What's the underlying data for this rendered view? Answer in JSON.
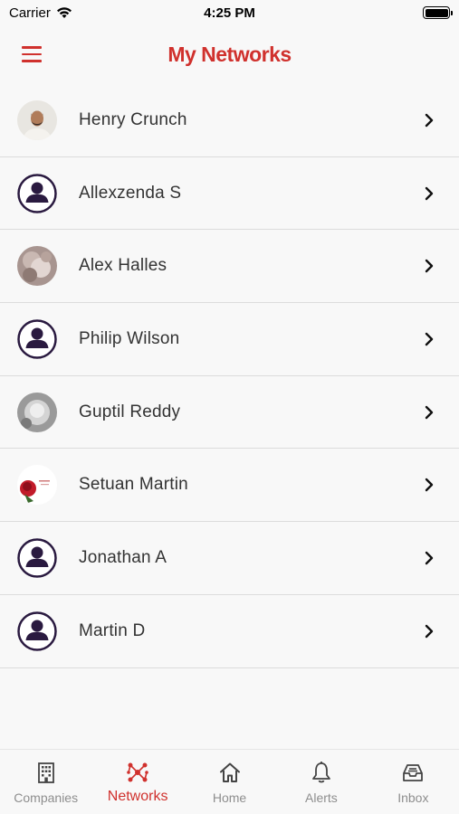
{
  "status_bar": {
    "carrier": "Carrier",
    "time": "4:25 PM"
  },
  "header": {
    "title": "My Networks"
  },
  "contacts": [
    {
      "name": "Henry Crunch",
      "avatar": "photo-man"
    },
    {
      "name": "Allexzenda S",
      "avatar": "default-user-icon"
    },
    {
      "name": "Alex Halles",
      "avatar": "photo-blurred"
    },
    {
      "name": "Philip Wilson",
      "avatar": "default-user-icon"
    },
    {
      "name": "Guptil Reddy",
      "avatar": "photo-grey"
    },
    {
      "name": "Setuan Martin",
      "avatar": "photo-rose"
    },
    {
      "name": "Jonathan A",
      "avatar": "default-user-icon"
    },
    {
      "name": "Martin D",
      "avatar": "default-user-icon"
    }
  ],
  "tabs": [
    {
      "label": "Companies",
      "icon": "building-icon",
      "active": false
    },
    {
      "label": "Networks",
      "icon": "network-icon",
      "active": true
    },
    {
      "label": "Home",
      "icon": "home-icon",
      "active": false
    },
    {
      "label": "Alerts",
      "icon": "bell-icon",
      "active": false
    },
    {
      "label": "Inbox",
      "icon": "inbox-icon",
      "active": false
    }
  ],
  "colors": {
    "accent": "#d0312d",
    "avatar_icon": "#2a1a40",
    "inactive_tab": "#8e8e8e"
  }
}
